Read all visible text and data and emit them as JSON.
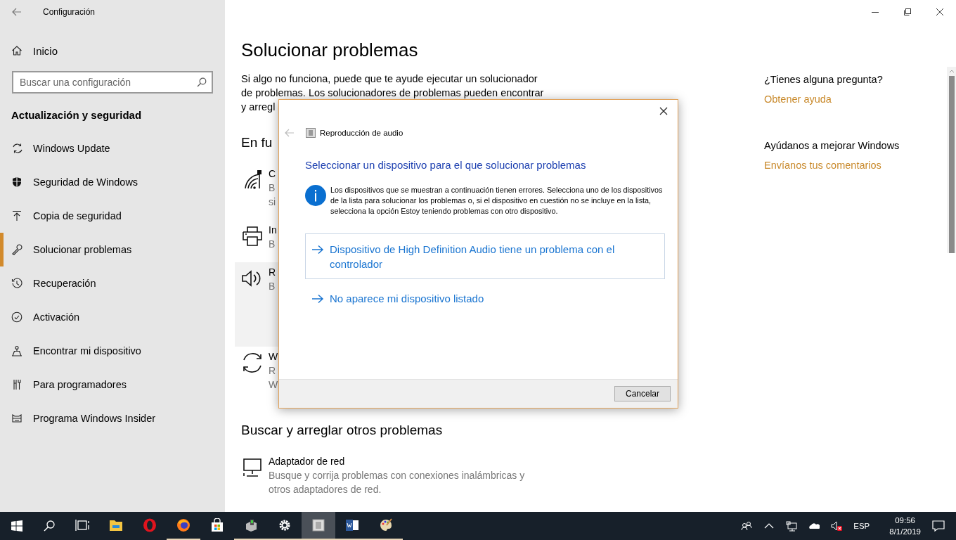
{
  "window": {
    "title": "Configuración"
  },
  "sidebar": {
    "home": "Inicio",
    "search": {
      "placeholder": "Buscar una configuración"
    },
    "section": "Actualización y seguridad",
    "items": [
      {
        "label": "Windows Update",
        "selected": false
      },
      {
        "label": "Seguridad de Windows",
        "selected": false
      },
      {
        "label": "Copia de seguridad",
        "selected": false
      },
      {
        "label": "Solucionar problemas",
        "selected": true
      },
      {
        "label": "Recuperación",
        "selected": false
      },
      {
        "label": "Activación",
        "selected": false
      },
      {
        "label": "Encontrar mi dispositivo",
        "selected": false
      },
      {
        "label": "Para programadores",
        "selected": false
      },
      {
        "label": "Programa Windows Insider",
        "selected": false
      }
    ]
  },
  "main": {
    "title": "Solucionar problemas",
    "intro": "Si algo no funciona, puede que te ayude ejecutar un solucionador\nde problemas. Los solucionadores de problemas pueden encontrar\ny arregl",
    "section": "En fu",
    "troubleshooters": [
      {
        "title": "C",
        "lines": [
          "B",
          "si"
        ],
        "selected": false
      },
      {
        "title": "In",
        "lines": [
          "B"
        ],
        "selected": false
      },
      {
        "title": "R",
        "lines": [
          "B"
        ],
        "selected": true
      },
      {
        "title": "W",
        "lines": [
          "R",
          "W"
        ],
        "selected": false
      }
    ],
    "other_section": "Buscar y arreglar otros problemas",
    "other": [
      {
        "title": "Adaptador de red",
        "lines": [
          "Busque y corrija problemas con conexiones inalámbricas y",
          "otros adaptadores de red."
        ],
        "selected": false
      }
    ]
  },
  "aside": [
    {
      "question": "¿Tienes alguna pregunta?",
      "link": "Obtener ayuda"
    },
    {
      "question": "Ayúdanos a mejorar Windows",
      "link": "Envíanos tus comentarios"
    }
  ],
  "dialog": {
    "title": "Reproducción de audio",
    "heading": "Seleccionar un dispositivo para el que solucionar problemas",
    "info": "Los dispositivos que se muestran a continuación tienen errores. Selecciona uno de los dispositivos de la lista para solucionar los problemas o, si el dispositivo en cuestión no se incluye en la lista, selecciona la opción Estoy teniendo problemas con otro dispositivo.",
    "options": [
      {
        "label": "Dispositivo de High Definition Audio tiene un problema con el controlador",
        "selected": true
      },
      {
        "label": "No aparece mi dispositivo listado",
        "selected": false
      }
    ],
    "buttons": [
      "Cancelar"
    ]
  },
  "taskbar": {
    "apps": [
      {
        "running": false,
        "active": false
      },
      {
        "running": true,
        "active": false
      },
      {
        "running": false,
        "active": false
      },
      {
        "running": true,
        "active": false
      },
      {
        "running": true,
        "active": false
      },
      {
        "running": true,
        "active": true
      },
      {
        "running": true,
        "active": false
      },
      {
        "running": true,
        "active": false
      }
    ],
    "language": "ESP",
    "time": "09:56",
    "date": "8/1/2019"
  }
}
